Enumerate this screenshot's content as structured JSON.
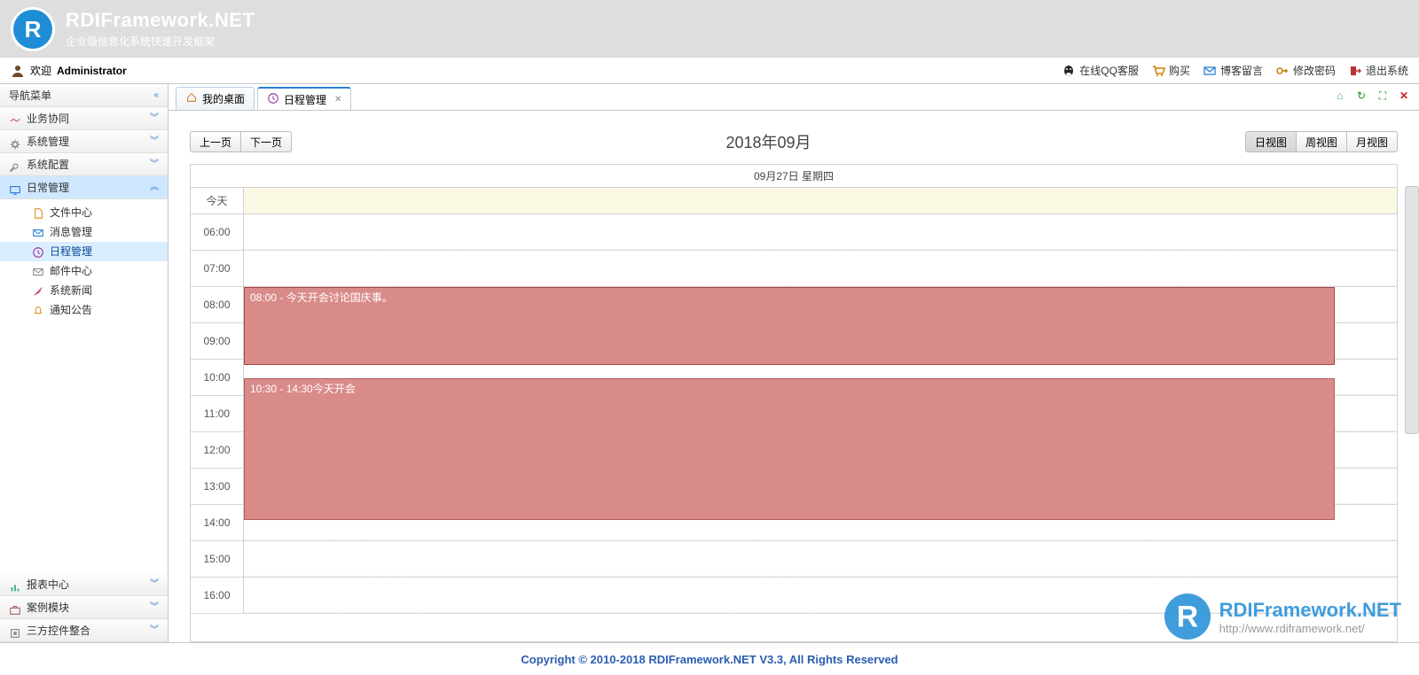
{
  "brand": {
    "title": "RDIFramework.NET",
    "subtitle": "企业级信息化系统快速开发框架"
  },
  "toolbar": {
    "welcome_prefix": "欢迎",
    "user": "Administrator",
    "links": {
      "qq": "在线QQ客服",
      "buy": "购买",
      "blog": "博客留言",
      "pwd": "修改密码",
      "logout": "退出系统"
    }
  },
  "sidebar": {
    "top_label": "导航菜单",
    "groups": [
      {
        "key": "biz",
        "label": "业务协同",
        "icon": "handshake",
        "expanded": false
      },
      {
        "key": "sysmgr",
        "label": "系统管理",
        "icon": "gear",
        "expanded": false
      },
      {
        "key": "syscfg",
        "label": "系统配置",
        "icon": "wrench",
        "expanded": false
      },
      {
        "key": "daily",
        "label": "日常管理",
        "icon": "monitor",
        "expanded": true,
        "children": [
          {
            "key": "file",
            "label": "文件中心",
            "icon": "file"
          },
          {
            "key": "msg",
            "label": "消息管理",
            "icon": "mail"
          },
          {
            "key": "sched",
            "label": "日程管理",
            "icon": "clock",
            "selected": true
          },
          {
            "key": "mail",
            "label": "邮件中心",
            "icon": "envelope"
          },
          {
            "key": "news",
            "label": "系统新闻",
            "icon": "feather"
          },
          {
            "key": "notice",
            "label": "通知公告",
            "icon": "bell"
          }
        ]
      }
    ],
    "bottom_groups": [
      {
        "key": "report",
        "label": "报表中心",
        "icon": "bar"
      },
      {
        "key": "case",
        "label": "案例模块",
        "icon": "case"
      },
      {
        "key": "thirdparty",
        "label": "三方控件整合",
        "icon": "plugin"
      }
    ]
  },
  "tabs": {
    "items": [
      {
        "key": "home",
        "label": "我的桌面",
        "icon": "home",
        "closable": false,
        "active": false
      },
      {
        "key": "sched",
        "label": "日程管理",
        "icon": "clock",
        "closable": true,
        "active": true
      }
    ]
  },
  "calendar": {
    "nav": {
      "prev": "上一页",
      "next": "下一页"
    },
    "title": "2018年09月",
    "views": {
      "day": "日视图",
      "week": "周视图",
      "month": "月视图",
      "active": "day"
    },
    "day_header": "09月27日 星期四",
    "allday_label": "今天",
    "hours": [
      "06:00",
      "07:00",
      "08:00",
      "09:00",
      "10:00",
      "11:00",
      "12:00",
      "13:00",
      "14:00",
      "15:00",
      "16:00"
    ],
    "events": [
      {
        "label": "08:00 - 今天开会讨论国庆事。",
        "start_index": 2,
        "duration_slots": 2.25
      },
      {
        "label": "10:30 - 14:30今天开会",
        "start_index": 4.5,
        "duration_slots": 4
      }
    ]
  },
  "footer": {
    "text": "Copyright © 2010-2018 RDIFramework.NET V3.3, All Rights Reserved"
  },
  "watermark": {
    "title": "RDIFramework.NET",
    "url": "http://www.rdiframework.net/"
  }
}
